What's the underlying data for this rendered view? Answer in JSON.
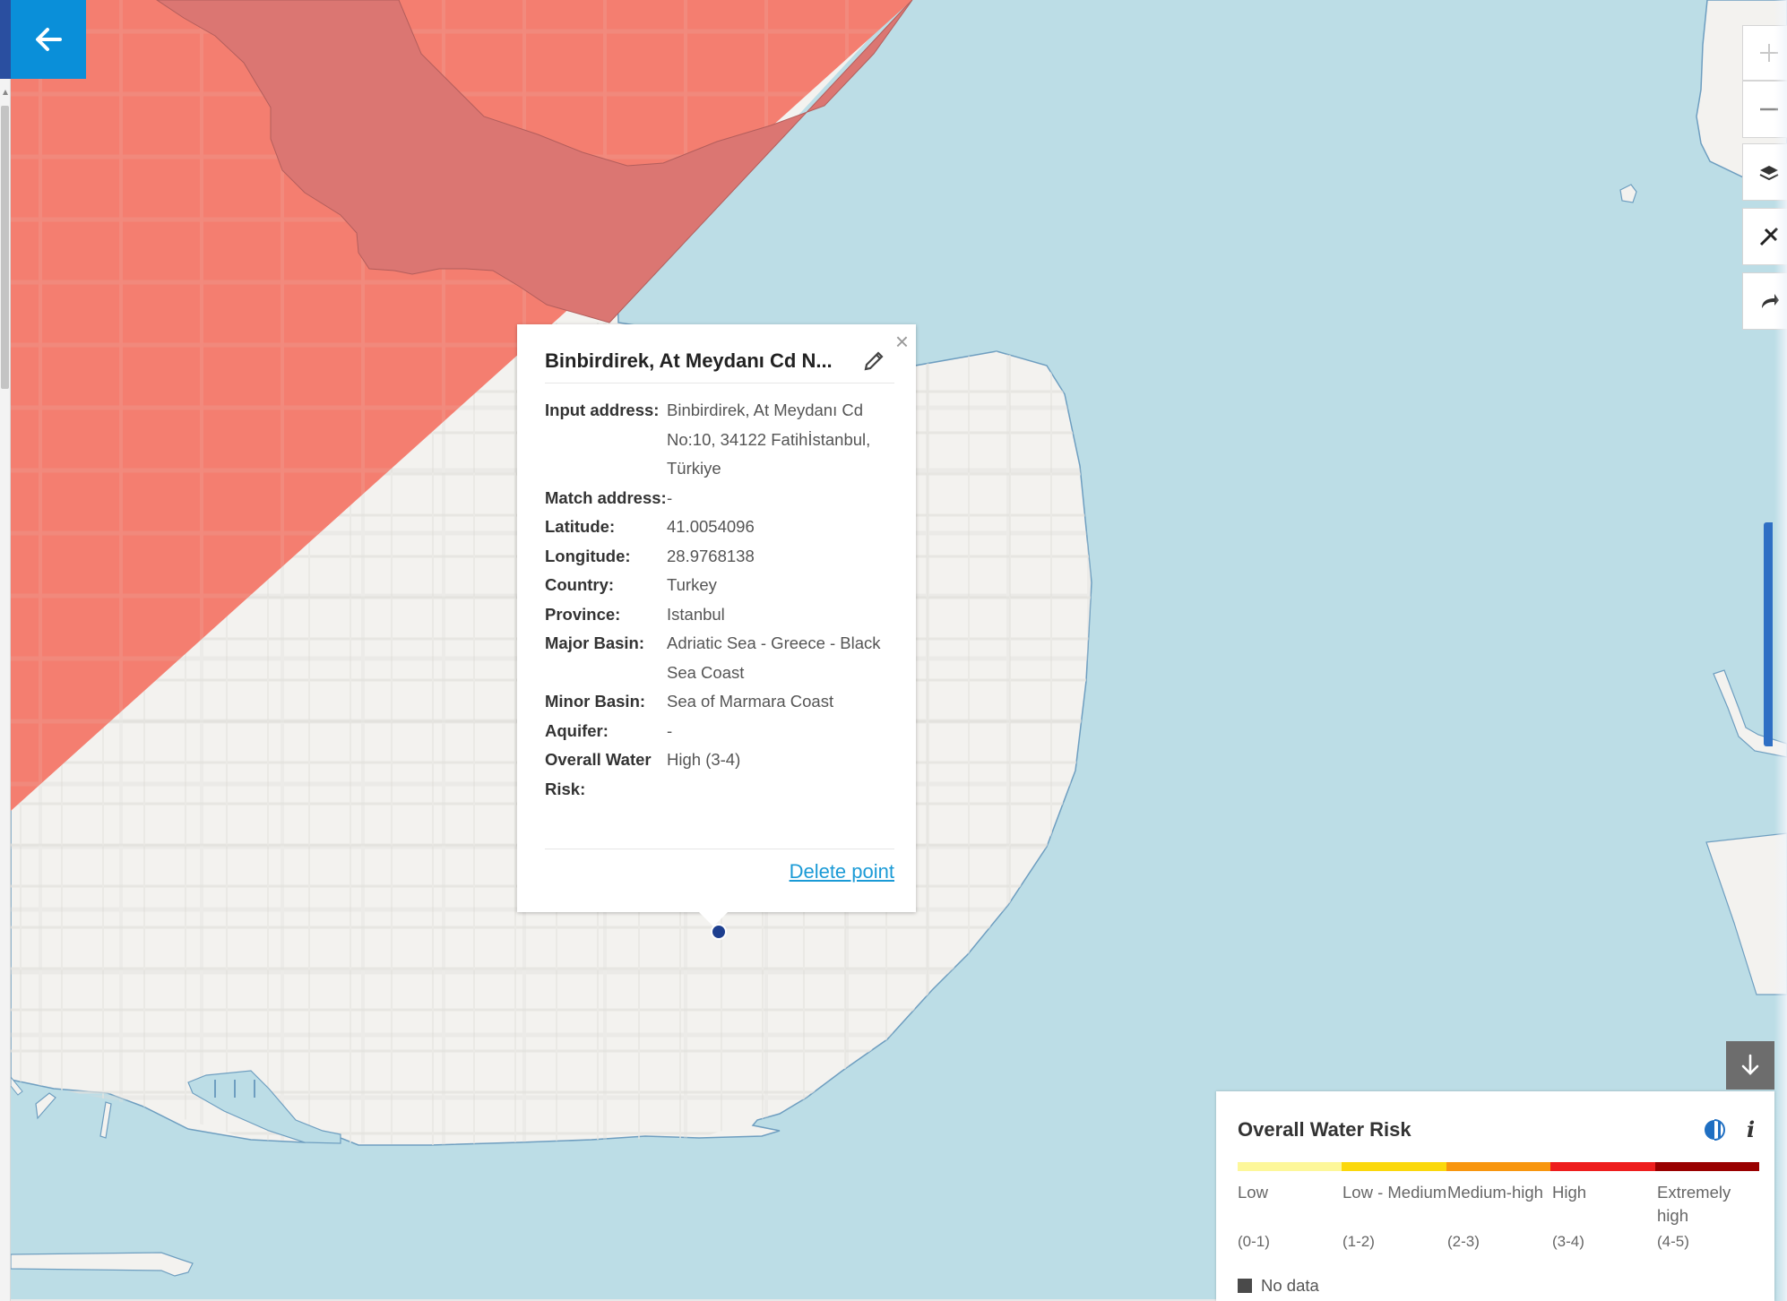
{
  "map": {
    "colors": {
      "water": "#bcdde6",
      "land": "#f3f2ef",
      "risk_high": "#f47e70",
      "risk_overlap": "#db7672",
      "coast_line": "#6e9ec0"
    }
  },
  "controls": {
    "back_icon": "arrow-left-icon",
    "zoom_in_icon": "plus-icon",
    "zoom_out_icon": "minus-icon",
    "layers_icon": "layers-icon",
    "measure_icon": "ruler-icon",
    "share_icon": "share-icon",
    "download_icon": "arrow-down-icon"
  },
  "popup": {
    "title": "Binbirdirek, At Meydanı Cd N...",
    "rows": [
      {
        "label": "Input address:",
        "value": "Binbirdirek, At Meydanı Cd No:10, 34122 Fatihİstanbul, Türkiye"
      },
      {
        "label": "Match address:",
        "value": "-"
      },
      {
        "label": "Latitude:",
        "value": "41.0054096"
      },
      {
        "label": "Longitude:",
        "value": "28.9768138"
      },
      {
        "label": "Country:",
        "value": "Turkey"
      },
      {
        "label": "Province:",
        "value": "Istanbul"
      },
      {
        "label": "Major Basin:",
        "value": "Adriatic Sea - Greece - Black Sea Coast"
      },
      {
        "label": "Minor Basin:",
        "value": "Sea of Marmara Coast"
      },
      {
        "label": "Aquifer:",
        "value": "-"
      },
      {
        "label": "Overall Water Risk:",
        "value": "High (3-4)"
      }
    ],
    "delete_label": "Delete point",
    "close_label": "×"
  },
  "legend": {
    "title": "Overall Water Risk",
    "categories": [
      {
        "label": "Low",
        "range": "(0-1)",
        "color": "#fdf79a"
      },
      {
        "label": "Low - Medium",
        "range": "(1-2)",
        "color": "#fbd80c"
      },
      {
        "label": "Medium-high",
        "range": "(2-3)",
        "color": "#f8960f"
      },
      {
        "label": "High",
        "range": "(3-4)",
        "color": "#ee1d1d"
      },
      {
        "label": "Extremely high",
        "range": "(4-5)",
        "color": "#990000"
      }
    ],
    "no_data_label": "No data",
    "info_label": "i"
  }
}
